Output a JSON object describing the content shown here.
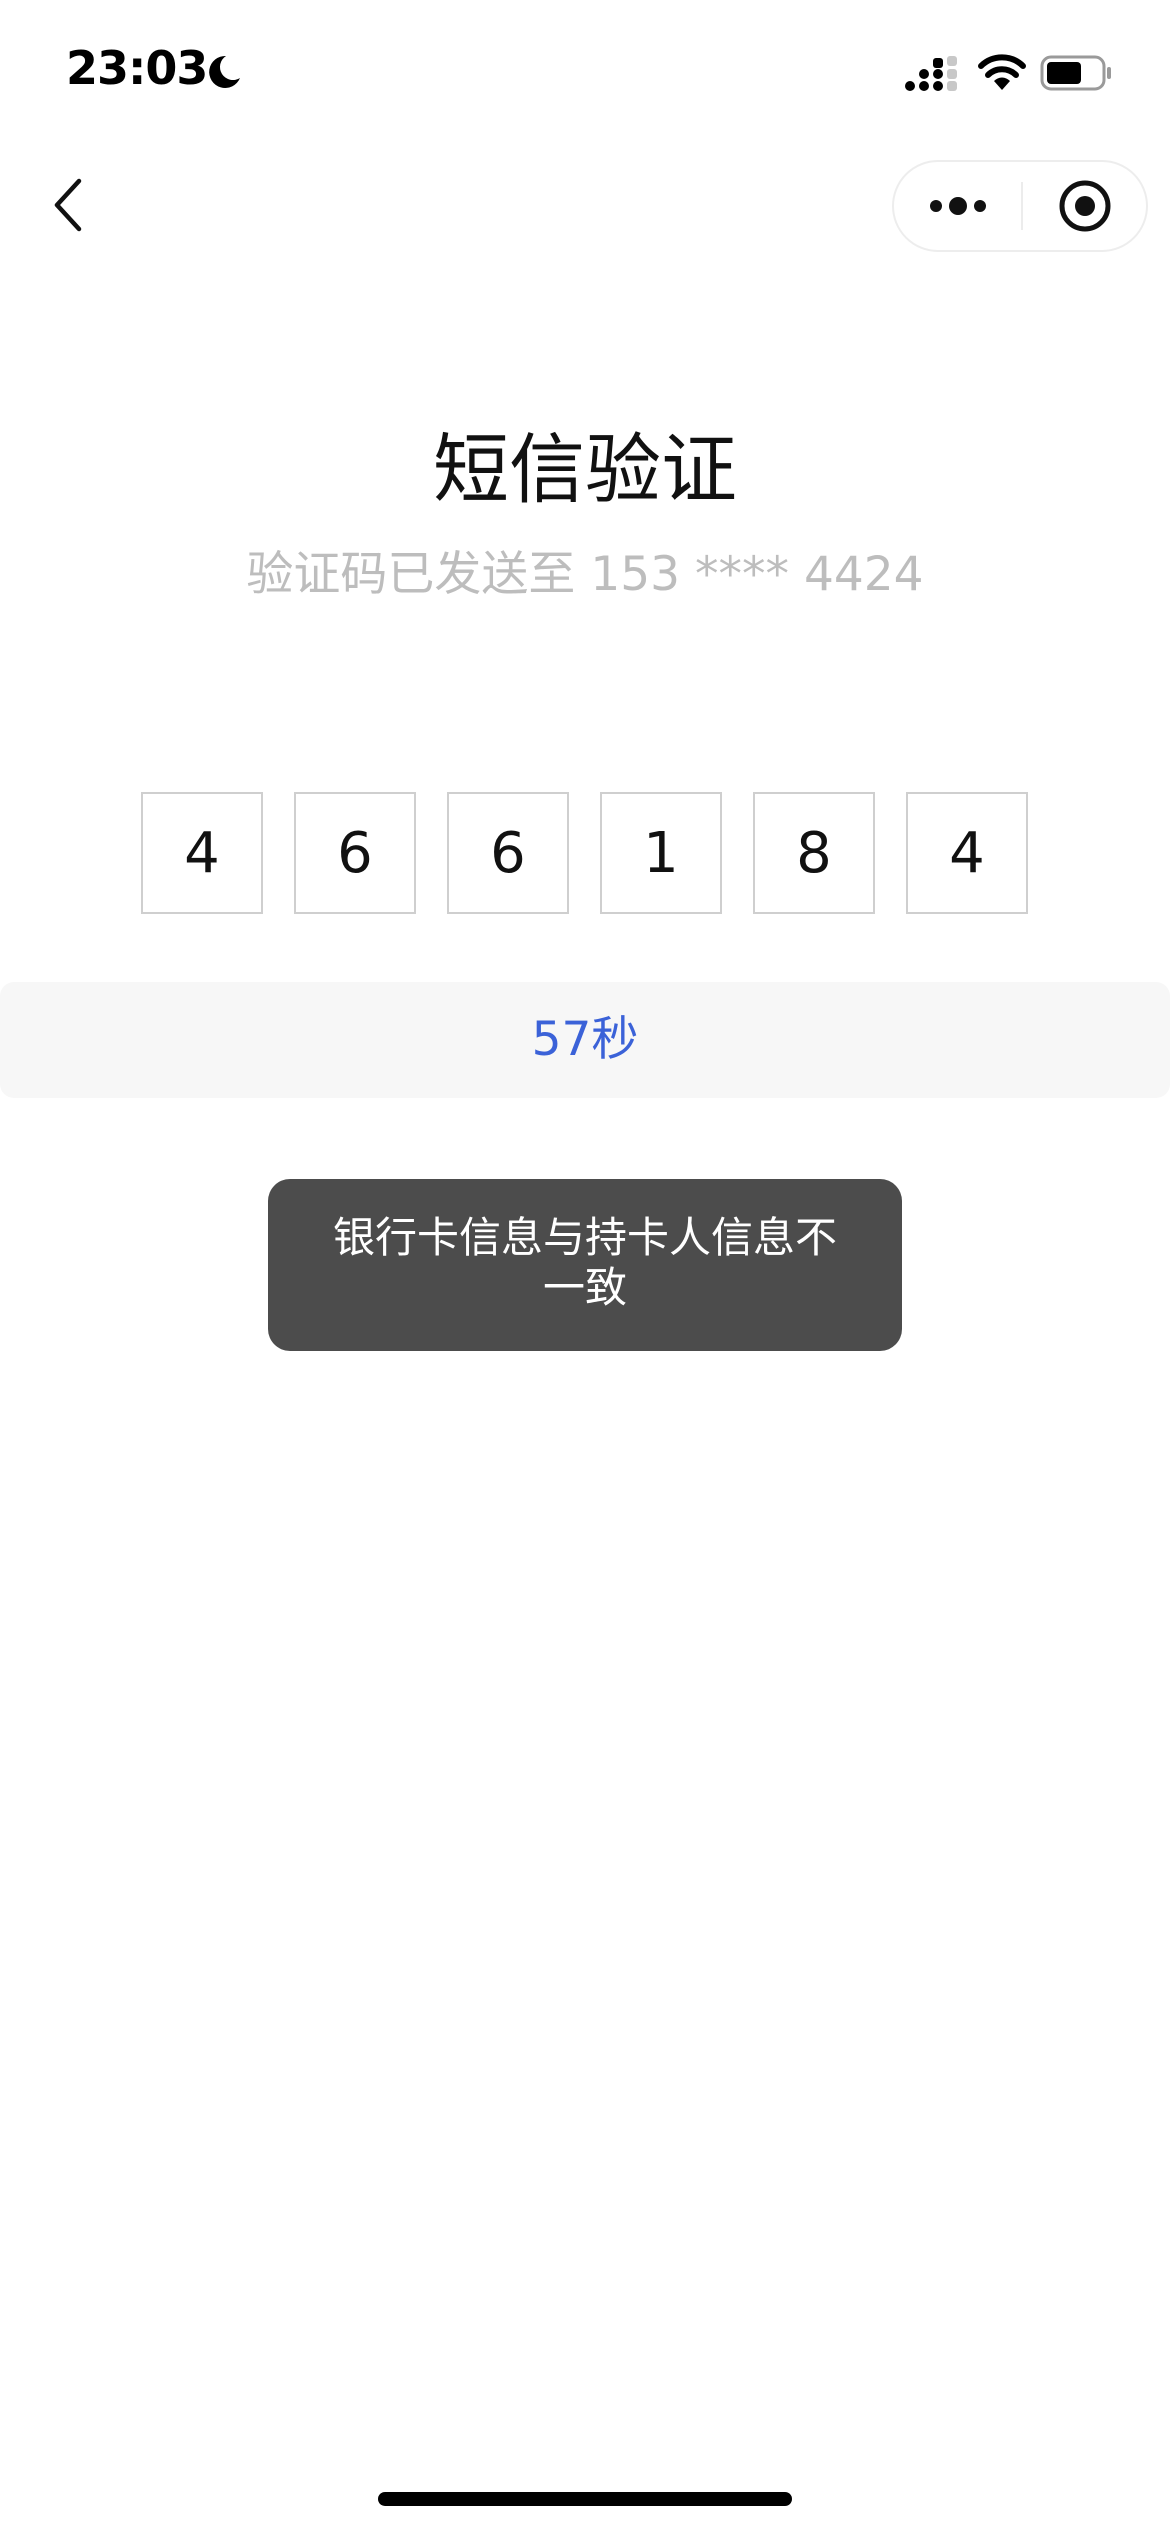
{
  "status_bar": {
    "time": "23:03"
  },
  "nav": {
    "back_icon": "chevron-left-icon",
    "more_icon": "more-dots-icon",
    "close_icon": "target-circle-icon"
  },
  "header": {
    "title": "短信验证",
    "subtitle": "验证码已发送至 153 **** 4424"
  },
  "verification_code": {
    "digits": [
      "4",
      "6",
      "6",
      "1",
      "8",
      "4"
    ]
  },
  "countdown": {
    "label": "57秒"
  },
  "toast": {
    "message": "银行卡信息与持卡人信息不一致"
  },
  "colors": {
    "accent": "#3b62d8",
    "subtitle_gray": "#bdbdbd",
    "toast_bg": "#4c4c4c"
  }
}
